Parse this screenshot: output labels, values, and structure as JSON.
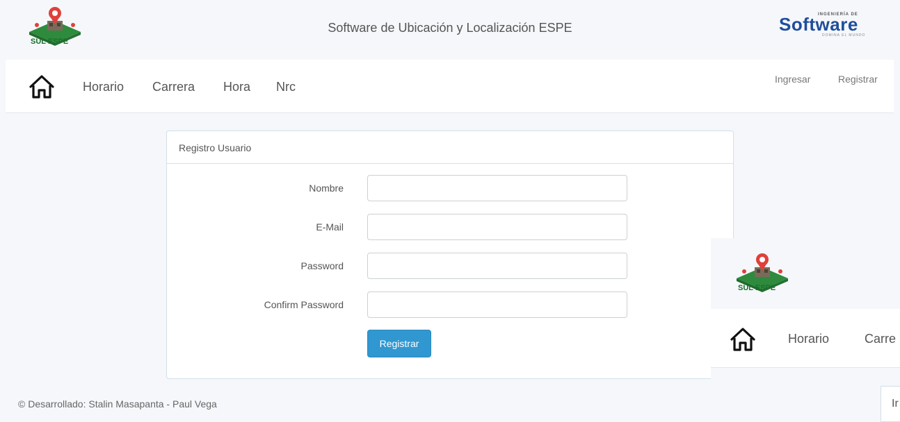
{
  "header": {
    "logo_text": "SUL ESPE",
    "title": "Software de Ubicación y Localización ESPE",
    "brand_text": "Software",
    "brand_sub": "INGENIERÍA DE",
    "brand_sub2": "DOMINA EL MUNDO"
  },
  "nav": {
    "links": [
      "Horario",
      "Carrera",
      "Hora",
      "Nrc"
    ],
    "login": "Ingresar",
    "register": "Registrar"
  },
  "form": {
    "title": "Registro Usuario",
    "fields": [
      {
        "label": "Nombre",
        "value": ""
      },
      {
        "label": "E-Mail",
        "value": ""
      },
      {
        "label": "Password",
        "value": ""
      },
      {
        "label": "Confirm Password",
        "value": ""
      }
    ],
    "submit": "Registrar"
  },
  "footer": {
    "text": "© Desarrollado: Stalin Masapanta - Paul Vega"
  },
  "overlay": {
    "logo_text": "SUL ESPE",
    "links": [
      "Horario",
      "Carre"
    ],
    "box_text": "Ir"
  },
  "colors": {
    "primary": "#3097d1",
    "logo_green": "#2e8b3d",
    "logo_red": "#e0403a",
    "brand_blue": "#1f4e9a"
  }
}
